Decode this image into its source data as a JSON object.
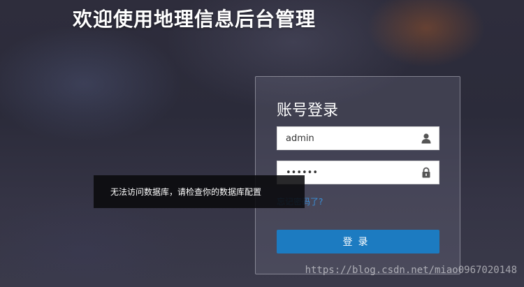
{
  "page": {
    "title": "欢迎使用地理信息后台管理"
  },
  "login": {
    "title": "账号登录",
    "username_value": "admin",
    "password_value": "••••••",
    "forgot_link": "忘记密码了?",
    "submit_label": "登录"
  },
  "toast": {
    "message": "无法访问数据库，请检查你的数据库配置"
  },
  "watermark": "https://blog.csdn.net/miao0967020148",
  "colors": {
    "accent": "#1c7bc1",
    "link": "#3a8fd8"
  },
  "icons": {
    "username": "user-icon",
    "password": "lock-icon"
  }
}
